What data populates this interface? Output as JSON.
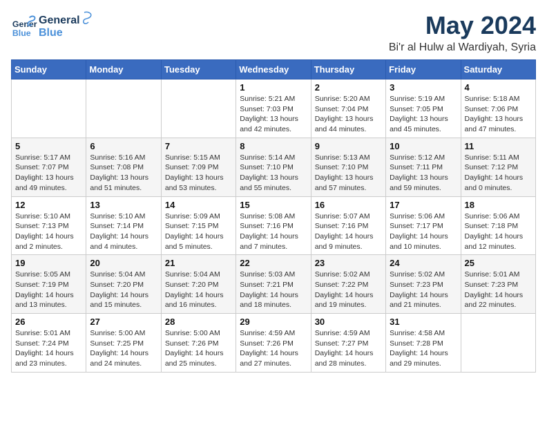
{
  "header": {
    "logo_general": "General",
    "logo_blue": "Blue",
    "month": "May 2024",
    "location": "Bi'r al Hulw al Wardiyah, Syria"
  },
  "weekdays": [
    "Sunday",
    "Monday",
    "Tuesday",
    "Wednesday",
    "Thursday",
    "Friday",
    "Saturday"
  ],
  "weeks": [
    [
      {
        "day": "",
        "info": ""
      },
      {
        "day": "",
        "info": ""
      },
      {
        "day": "",
        "info": ""
      },
      {
        "day": "1",
        "info": "Sunrise: 5:21 AM\nSunset: 7:03 PM\nDaylight: 13 hours\nand 42 minutes."
      },
      {
        "day": "2",
        "info": "Sunrise: 5:20 AM\nSunset: 7:04 PM\nDaylight: 13 hours\nand 44 minutes."
      },
      {
        "day": "3",
        "info": "Sunrise: 5:19 AM\nSunset: 7:05 PM\nDaylight: 13 hours\nand 45 minutes."
      },
      {
        "day": "4",
        "info": "Sunrise: 5:18 AM\nSunset: 7:06 PM\nDaylight: 13 hours\nand 47 minutes."
      }
    ],
    [
      {
        "day": "5",
        "info": "Sunrise: 5:17 AM\nSunset: 7:07 PM\nDaylight: 13 hours\nand 49 minutes."
      },
      {
        "day": "6",
        "info": "Sunrise: 5:16 AM\nSunset: 7:08 PM\nDaylight: 13 hours\nand 51 minutes."
      },
      {
        "day": "7",
        "info": "Sunrise: 5:15 AM\nSunset: 7:09 PM\nDaylight: 13 hours\nand 53 minutes."
      },
      {
        "day": "8",
        "info": "Sunrise: 5:14 AM\nSunset: 7:10 PM\nDaylight: 13 hours\nand 55 minutes."
      },
      {
        "day": "9",
        "info": "Sunrise: 5:13 AM\nSunset: 7:10 PM\nDaylight: 13 hours\nand 57 minutes."
      },
      {
        "day": "10",
        "info": "Sunrise: 5:12 AM\nSunset: 7:11 PM\nDaylight: 13 hours\nand 59 minutes."
      },
      {
        "day": "11",
        "info": "Sunrise: 5:11 AM\nSunset: 7:12 PM\nDaylight: 14 hours\nand 0 minutes."
      }
    ],
    [
      {
        "day": "12",
        "info": "Sunrise: 5:10 AM\nSunset: 7:13 PM\nDaylight: 14 hours\nand 2 minutes."
      },
      {
        "day": "13",
        "info": "Sunrise: 5:10 AM\nSunset: 7:14 PM\nDaylight: 14 hours\nand 4 minutes."
      },
      {
        "day": "14",
        "info": "Sunrise: 5:09 AM\nSunset: 7:15 PM\nDaylight: 14 hours\nand 5 minutes."
      },
      {
        "day": "15",
        "info": "Sunrise: 5:08 AM\nSunset: 7:16 PM\nDaylight: 14 hours\nand 7 minutes."
      },
      {
        "day": "16",
        "info": "Sunrise: 5:07 AM\nSunset: 7:16 PM\nDaylight: 14 hours\nand 9 minutes."
      },
      {
        "day": "17",
        "info": "Sunrise: 5:06 AM\nSunset: 7:17 PM\nDaylight: 14 hours\nand 10 minutes."
      },
      {
        "day": "18",
        "info": "Sunrise: 5:06 AM\nSunset: 7:18 PM\nDaylight: 14 hours\nand 12 minutes."
      }
    ],
    [
      {
        "day": "19",
        "info": "Sunrise: 5:05 AM\nSunset: 7:19 PM\nDaylight: 14 hours\nand 13 minutes."
      },
      {
        "day": "20",
        "info": "Sunrise: 5:04 AM\nSunset: 7:20 PM\nDaylight: 14 hours\nand 15 minutes."
      },
      {
        "day": "21",
        "info": "Sunrise: 5:04 AM\nSunset: 7:20 PM\nDaylight: 14 hours\nand 16 minutes."
      },
      {
        "day": "22",
        "info": "Sunrise: 5:03 AM\nSunset: 7:21 PM\nDaylight: 14 hours\nand 18 minutes."
      },
      {
        "day": "23",
        "info": "Sunrise: 5:02 AM\nSunset: 7:22 PM\nDaylight: 14 hours\nand 19 minutes."
      },
      {
        "day": "24",
        "info": "Sunrise: 5:02 AM\nSunset: 7:23 PM\nDaylight: 14 hours\nand 21 minutes."
      },
      {
        "day": "25",
        "info": "Sunrise: 5:01 AM\nSunset: 7:23 PM\nDaylight: 14 hours\nand 22 minutes."
      }
    ],
    [
      {
        "day": "26",
        "info": "Sunrise: 5:01 AM\nSunset: 7:24 PM\nDaylight: 14 hours\nand 23 minutes."
      },
      {
        "day": "27",
        "info": "Sunrise: 5:00 AM\nSunset: 7:25 PM\nDaylight: 14 hours\nand 24 minutes."
      },
      {
        "day": "28",
        "info": "Sunrise: 5:00 AM\nSunset: 7:26 PM\nDaylight: 14 hours\nand 25 minutes."
      },
      {
        "day": "29",
        "info": "Sunrise: 4:59 AM\nSunset: 7:26 PM\nDaylight: 14 hours\nand 27 minutes."
      },
      {
        "day": "30",
        "info": "Sunrise: 4:59 AM\nSunset: 7:27 PM\nDaylight: 14 hours\nand 28 minutes."
      },
      {
        "day": "31",
        "info": "Sunrise: 4:58 AM\nSunset: 7:28 PM\nDaylight: 14 hours\nand 29 minutes."
      },
      {
        "day": "",
        "info": ""
      }
    ]
  ]
}
